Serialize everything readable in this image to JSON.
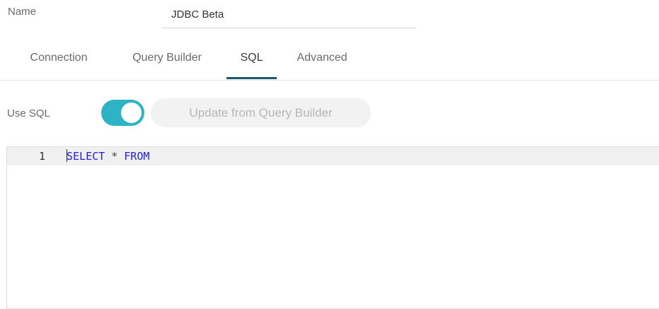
{
  "form": {
    "name_label": "Name",
    "name_value": "JDBC Beta"
  },
  "tabs": [
    {
      "label": "Connection",
      "active": false
    },
    {
      "label": "Query Builder",
      "active": false
    },
    {
      "label": "SQL",
      "active": true
    },
    {
      "label": "Advanced",
      "active": false
    }
  ],
  "sql": {
    "use_sql_label": "Use SQL",
    "use_sql_enabled": true,
    "update_button_label": "Update from Query Builder",
    "editor": {
      "lines": [
        {
          "number": "1",
          "tokens": [
            {
              "text": "SELECT",
              "type": "keyword"
            },
            {
              "text": " * ",
              "type": "operator"
            },
            {
              "text": "FROM",
              "type": "keyword"
            }
          ]
        }
      ]
    }
  },
  "colors": {
    "toggle_on": "#2db3c3",
    "active_tab_underline": "#20566a",
    "keyword": "#1f1fd6",
    "button_bg": "#f2f2f2",
    "button_text": "#b6b6b6"
  }
}
